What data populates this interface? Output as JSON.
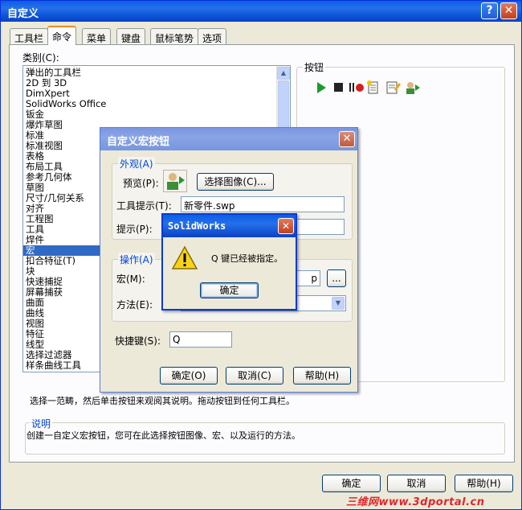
{
  "window": {
    "title": "自定义",
    "help_btn": "?",
    "close_btn": "✕"
  },
  "tabs": [
    "工具栏",
    "命令",
    "菜单",
    "键盘",
    "鼠标笔势",
    "选项"
  ],
  "category": {
    "label": "类别(C):",
    "items": [
      "弹出的工具栏",
      "2D 到 3D",
      "DimXpert",
      "SolidWorks Office",
      "钣金",
      "爆炸草图",
      "标准",
      "标准视图",
      "表格",
      "布局工具",
      "参考几何体",
      "草图",
      "尺寸/几何关系",
      "对齐",
      "工程图",
      "工具",
      "焊件",
      "宏",
      "扣合特征(T)",
      "块",
      "快速捕捉",
      "屏幕捕获",
      "曲面",
      "曲线",
      "视图",
      "特征",
      "线型",
      "选择过滤器",
      "样条曲线工具"
    ],
    "selected": "宏"
  },
  "buttons_group": {
    "label": "按钮"
  },
  "hint_text": "选择一范畴，然后单击按钮来观阅其说明。拖动按钮到任何工具栏。",
  "description": {
    "label": "说明",
    "text": "创建一自定义宏按钮，您可在此选择按钮图像、宏、以及运行的方法。"
  },
  "footer": {
    "ok": "确定",
    "cancel": "取消",
    "help": "帮助(H)"
  },
  "macro_dialog": {
    "title": "自定义宏按钮",
    "appearance_label": "外观(A)",
    "preview_label": "预览(P):",
    "choose_image": "选择图像(C)...",
    "tooltip_label": "工具提示(T):",
    "tooltip_value": "新零件.swp",
    "prompt_label": "提示(P):",
    "action_label": "操作(A)",
    "macro_label": "宏(M):",
    "macro_value_tail": "p",
    "browse": "...",
    "method_label": "方法(E):",
    "shortcut_label": "快捷键(S):",
    "shortcut_value": "Q",
    "ok": "确定(O)",
    "cancel": "取消(C)",
    "help": "帮助(H)"
  },
  "message_box": {
    "title": "SolidWorks",
    "text": "Q 键已经被指定。",
    "ok": "确定"
  },
  "watermark": "三维网www.3dportal.cn"
}
